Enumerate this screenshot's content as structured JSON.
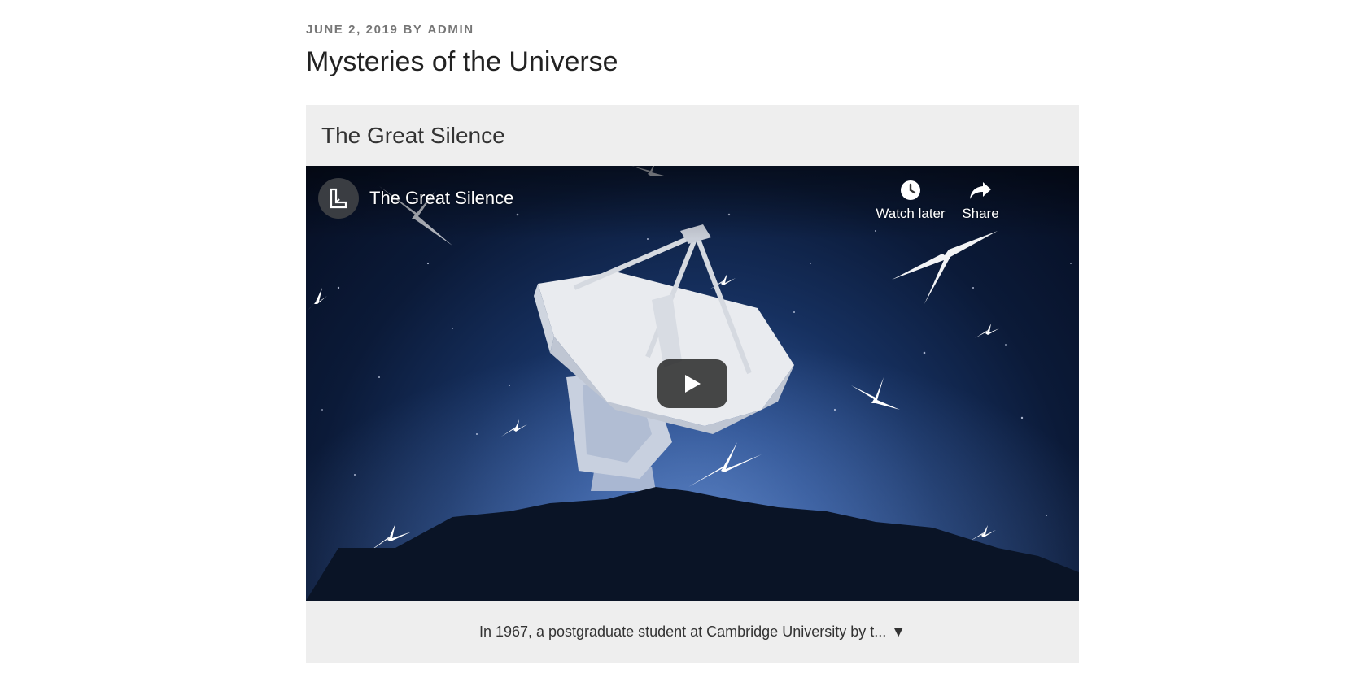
{
  "post": {
    "date": "June 2, 2019",
    "by_word": "by",
    "author": "admin",
    "title": "Mysteries of the Universe"
  },
  "card": {
    "heading": "The Great Silence",
    "caption": "In 1967, a postgraduate student at Cambridge University by t...",
    "caption_toggle": "▼"
  },
  "video": {
    "title": "The Great Silence",
    "watch_later_label": "Watch later",
    "share_label": "Share",
    "icons": {
      "channel": "channel-logo-icon",
      "watch_later": "clock-icon",
      "share": "share-arrow-icon",
      "play": "play-icon"
    }
  },
  "colors": {
    "meta": "#767676",
    "card_bg": "#eeeeee",
    "play_button": "#212121"
  }
}
